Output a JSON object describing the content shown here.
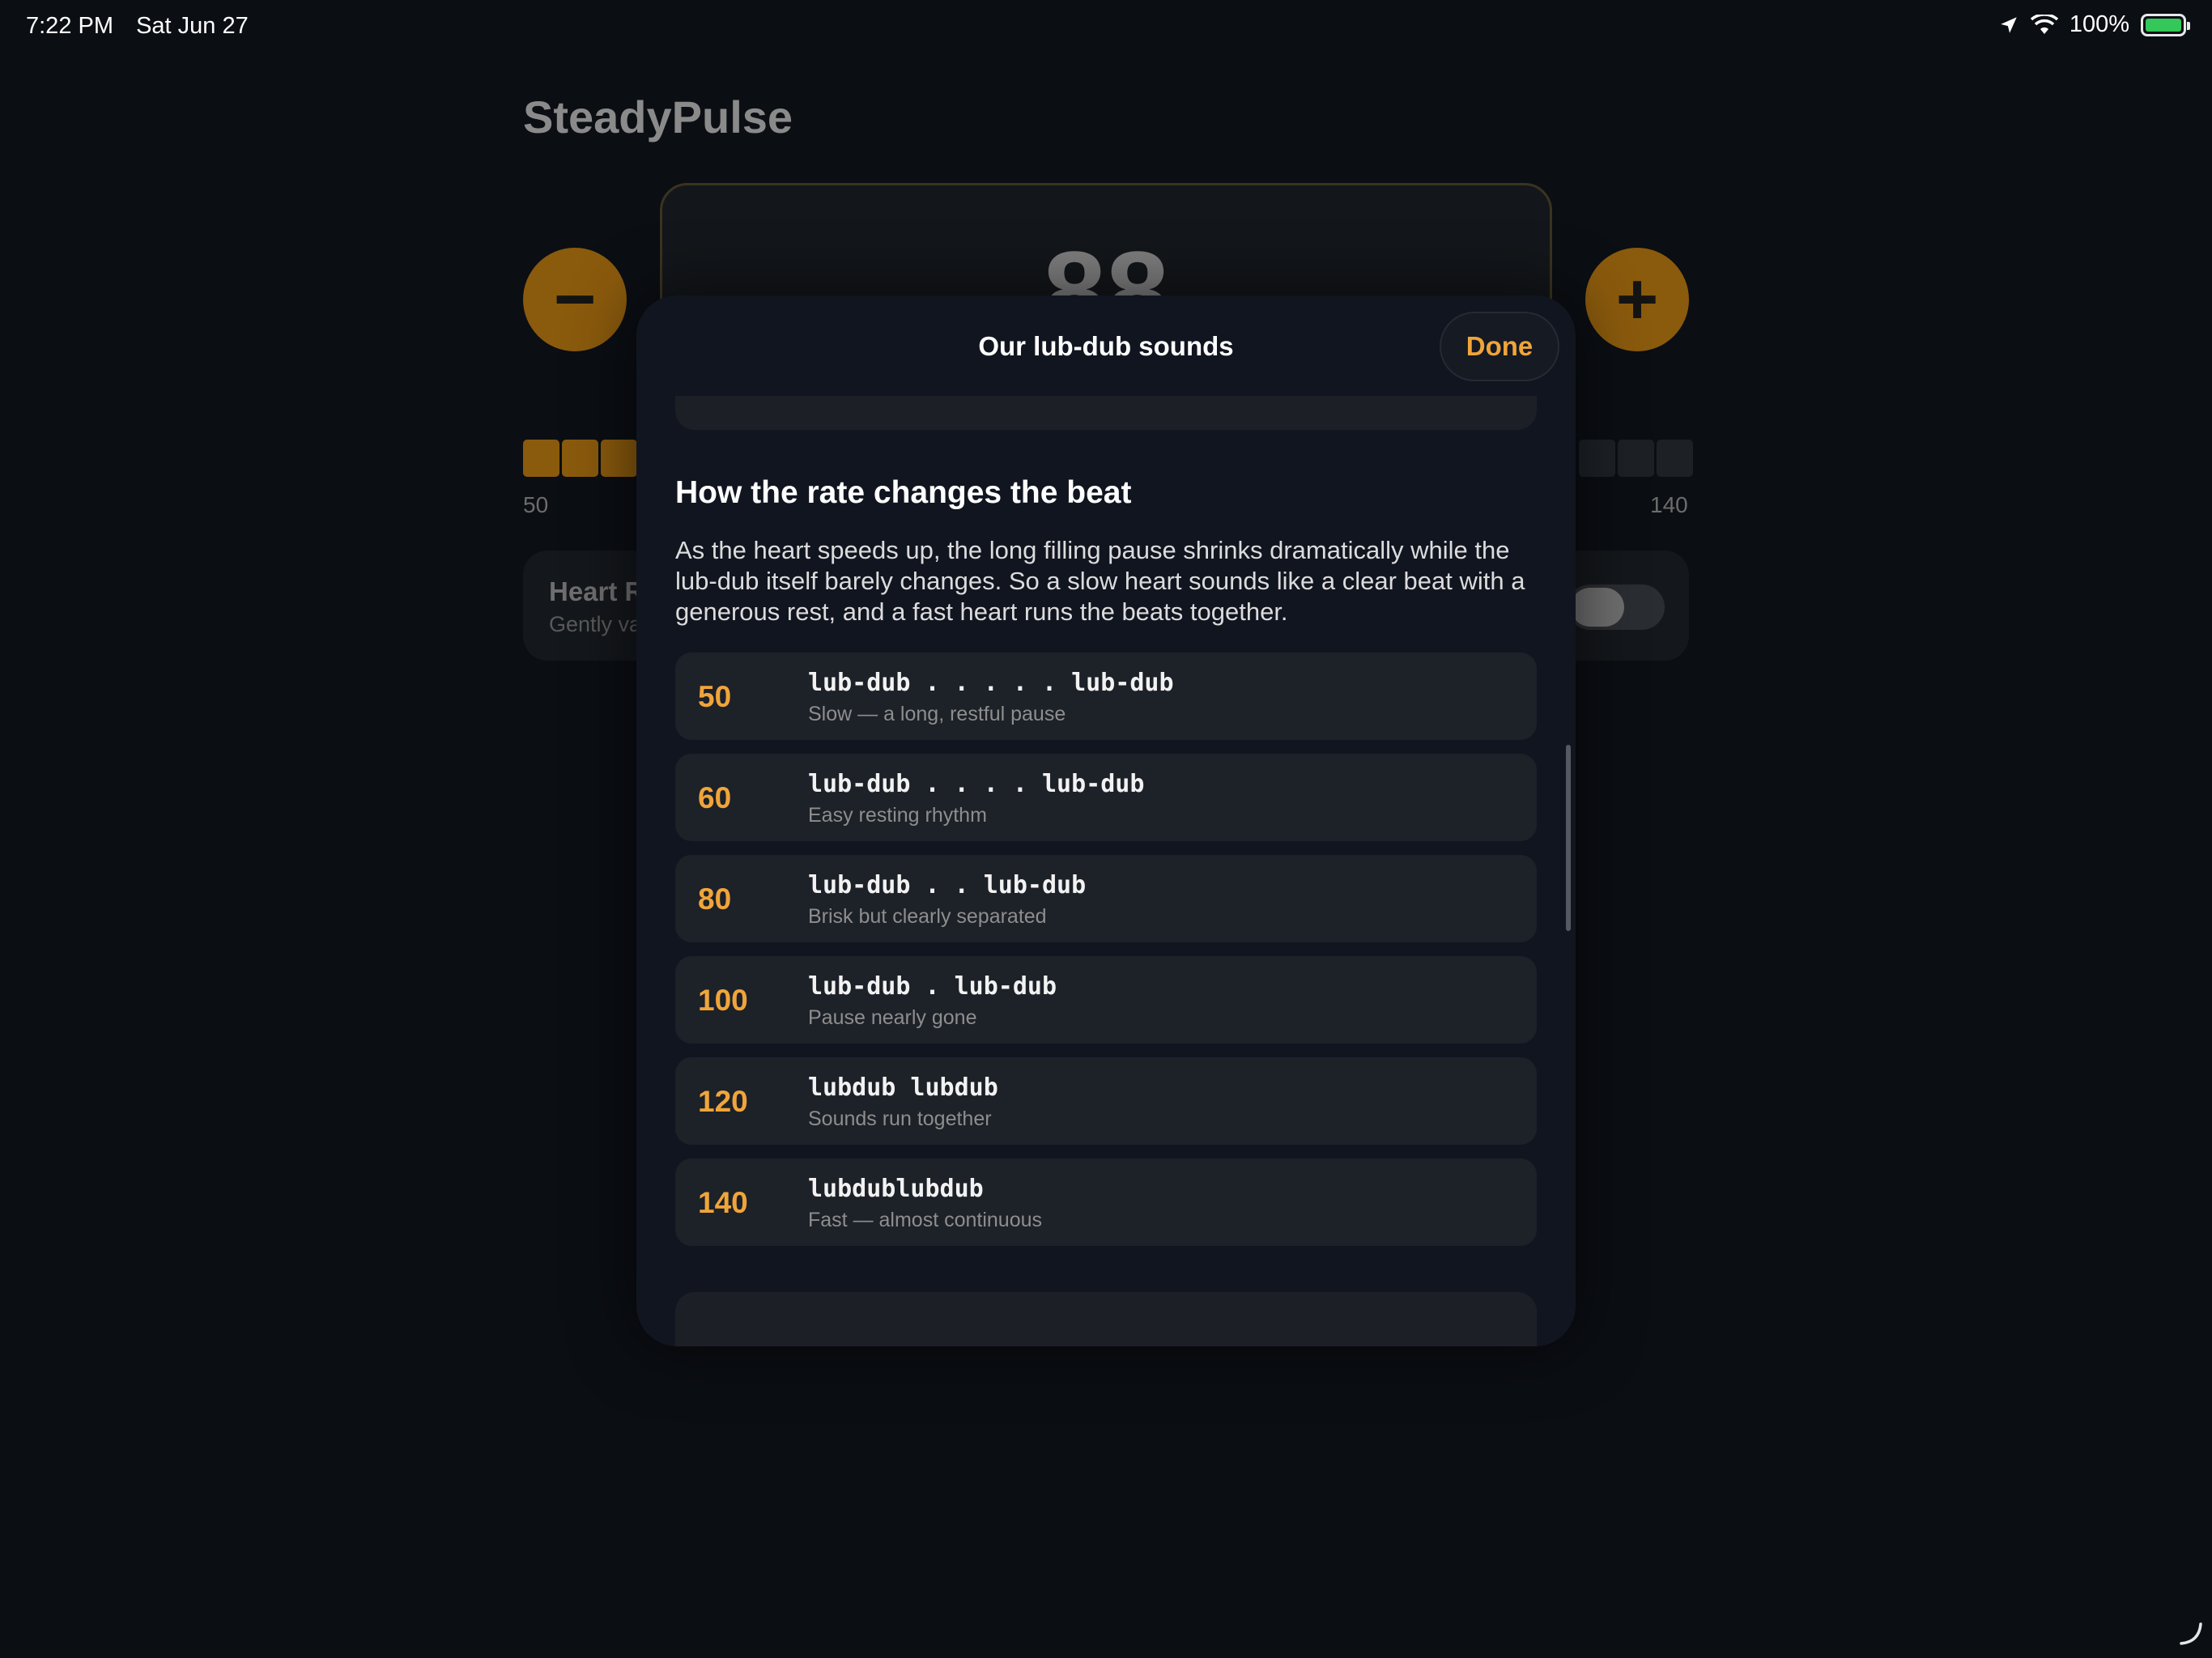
{
  "status_bar": {
    "time": "7:22 PM",
    "date": "Sat Jun 27",
    "battery": "100%"
  },
  "app": {
    "title": "SteadyPulse",
    "bpm_value": "88",
    "minus_label": "−",
    "plus_label": "+",
    "range_min": "50",
    "range_max": "140",
    "variation": {
      "title": "Heart R",
      "subtitle": "Gently va"
    }
  },
  "sheet": {
    "title": "Our lub-dub sounds",
    "done_label": "Done",
    "section_heading": "How the rate changes the beat",
    "section_body": "As the heart speeds up, the long filling pause shrinks dramatically while the lub-dub itself barely changes. So a slow heart sounds like a clear beat with a generous rest, and a fast heart runs the beats together.",
    "rates": [
      {
        "bpm": "50",
        "pattern": "lub-dub . . . . . lub-dub",
        "desc": "Slow — a long, restful pause"
      },
      {
        "bpm": "60",
        "pattern": "lub-dub . . . . lub-dub",
        "desc": "Easy resting rhythm"
      },
      {
        "bpm": "80",
        "pattern": "lub-dub . . lub-dub",
        "desc": "Brisk but clearly separated"
      },
      {
        "bpm": "100",
        "pattern": "lub-dub . lub-dub",
        "desc": "Pause nearly gone"
      },
      {
        "bpm": "120",
        "pattern": "lubdub lubdub",
        "desc": "Sounds run together"
      },
      {
        "bpm": "140",
        "pattern": "lubdublubdub",
        "desc": "Fast — almost continuous"
      }
    ]
  },
  "colors": {
    "accent": "#f0a53a",
    "background": "#0b0e13",
    "sheet": "#111520",
    "row": "#1d2128"
  },
  "icons": [
    "location-arrow-icon",
    "wifi-icon",
    "battery-charging-icon",
    "minus-icon",
    "plus-icon",
    "corner-gesture-icon"
  ]
}
